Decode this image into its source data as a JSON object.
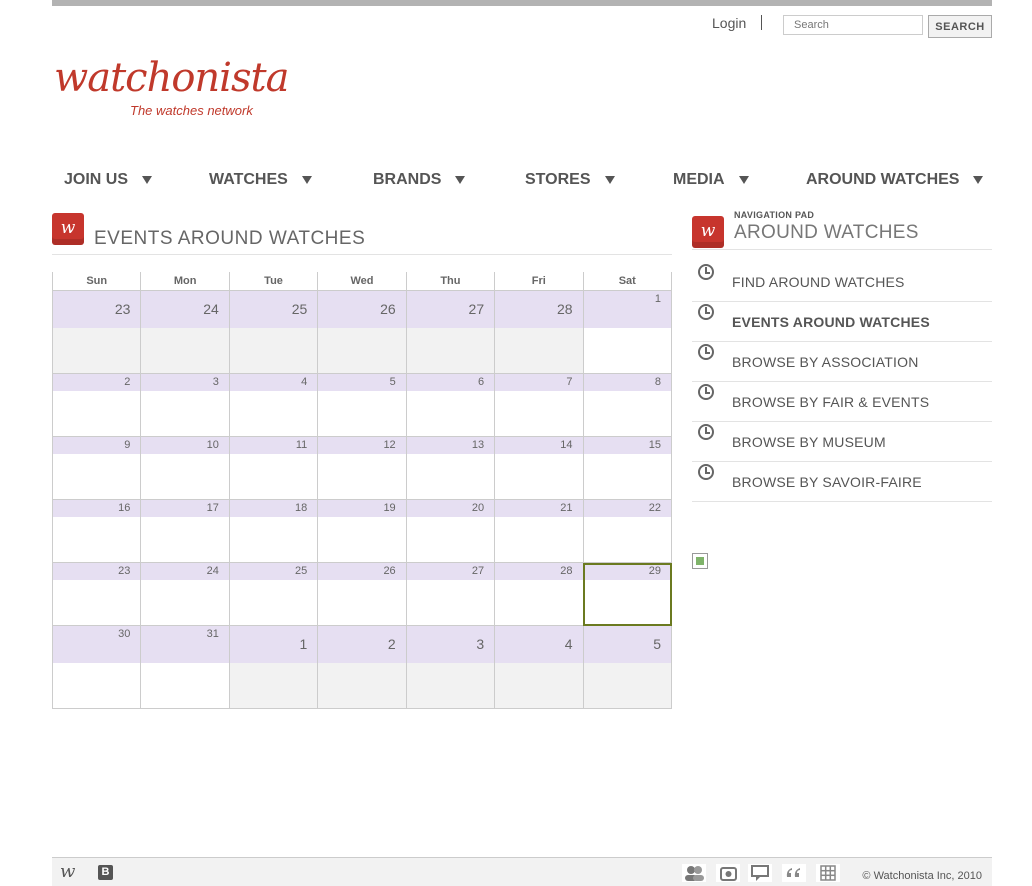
{
  "header": {
    "login_label": "Login",
    "search_placeholder": "Search",
    "search_button": "SEARCH"
  },
  "logo": {
    "name": "watchonista",
    "tagline": "The watches network"
  },
  "nav": {
    "items": [
      {
        "label": "JOIN US"
      },
      {
        "label": "WATCHES"
      },
      {
        "label": "BRANDS"
      },
      {
        "label": "STORES"
      },
      {
        "label": "MEDIA"
      },
      {
        "label": "AROUND WATCHES"
      }
    ]
  },
  "events": {
    "title": "EVENTS AROUND WATCHES",
    "weekdays": [
      "Sun",
      "Mon",
      "Tue",
      "Wed",
      "Thu",
      "Fri",
      "Sat"
    ],
    "weeks": [
      [
        {
          "day": "23",
          "other": true
        },
        {
          "day": "24",
          "other": true
        },
        {
          "day": "25",
          "other": true
        },
        {
          "day": "26",
          "other": true
        },
        {
          "day": "27",
          "other": true
        },
        {
          "day": "28",
          "other": true
        },
        {
          "day": "1",
          "other": false
        }
      ],
      [
        {
          "day": "2",
          "other": false
        },
        {
          "day": "3",
          "other": false
        },
        {
          "day": "4",
          "other": false
        },
        {
          "day": "5",
          "other": false
        },
        {
          "day": "6",
          "other": false
        },
        {
          "day": "7",
          "other": false
        },
        {
          "day": "8",
          "other": false
        }
      ],
      [
        {
          "day": "9",
          "other": false
        },
        {
          "day": "10",
          "other": false
        },
        {
          "day": "11",
          "other": false
        },
        {
          "day": "12",
          "other": false
        },
        {
          "day": "13",
          "other": false
        },
        {
          "day": "14",
          "other": false
        },
        {
          "day": "15",
          "other": false
        }
      ],
      [
        {
          "day": "16",
          "other": false
        },
        {
          "day": "17",
          "other": false
        },
        {
          "day": "18",
          "other": false
        },
        {
          "day": "19",
          "other": false
        },
        {
          "day": "20",
          "other": false
        },
        {
          "day": "21",
          "other": false
        },
        {
          "day": "22",
          "other": false
        }
      ],
      [
        {
          "day": "23",
          "other": false
        },
        {
          "day": "24",
          "other": false
        },
        {
          "day": "25",
          "other": false
        },
        {
          "day": "26",
          "other": false
        },
        {
          "day": "27",
          "other": false
        },
        {
          "day": "28",
          "other": false
        },
        {
          "day": "29",
          "other": false,
          "today": true
        }
      ],
      [
        {
          "day": "30",
          "other": false
        },
        {
          "day": "31",
          "other": false
        },
        {
          "day": "1",
          "other": true
        },
        {
          "day": "2",
          "other": true
        },
        {
          "day": "3",
          "other": true
        },
        {
          "day": "4",
          "other": true
        },
        {
          "day": "5",
          "other": true
        }
      ]
    ]
  },
  "nav_pad": {
    "label": "NAVIGATION PAD",
    "title": "AROUND WATCHES",
    "items": [
      {
        "label": "FIND AROUND WATCHES",
        "active": false
      },
      {
        "label": "EVENTS AROUND WATCHES",
        "active": true
      },
      {
        "label": "BROWSE BY ASSOCIATION",
        "active": false
      },
      {
        "label": "BROWSE BY FAIR & EVENTS",
        "active": false
      },
      {
        "label": "BROWSE BY MUSEUM",
        "active": false
      },
      {
        "label": "BROWSE BY SAVOIR-FAIRE",
        "active": false
      }
    ]
  },
  "footer": {
    "copyright": "© Watchonista Inc, 2010",
    "icons": [
      "members-icon",
      "photo-icon",
      "comment-icon",
      "quote-icon",
      "grid-icon"
    ]
  },
  "colors": {
    "brand": "#c0392b",
    "day_header": "#e6dff2",
    "other_month": "#f2f2f2",
    "today_border": "#6b7a20"
  }
}
